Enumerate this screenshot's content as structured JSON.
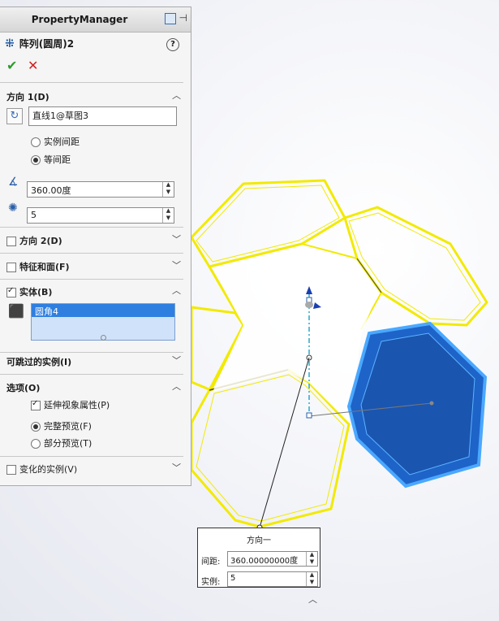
{
  "panel": {
    "title": "PropertyManager",
    "feature_name": "阵列(圆周)2",
    "help_label": "?",
    "ok_symbol": "✔",
    "cancel_symbol": "✕"
  },
  "direction1": {
    "title": "方向 1(D)",
    "axis_value": "直线1@草图3",
    "option_instance_spacing": "实例间距",
    "option_equal_spacing": "等间距",
    "angle_value": "360.00度",
    "count_value": "5"
  },
  "direction2": {
    "title": "方向 2(D)"
  },
  "features_faces": {
    "title": "特征和面(F)"
  },
  "bodies": {
    "title": "实体(B)",
    "selected": "圆角4"
  },
  "skip_instances": {
    "title": "可跳过的实例(I)"
  },
  "options": {
    "title": "选项(O)",
    "propagate": "延伸视象属性(P)",
    "full_preview": "完整预览(F)",
    "partial_preview": "部分预览(T)"
  },
  "vary_instances": {
    "title": "变化的实例(V)"
  },
  "callout": {
    "title": "方向一",
    "spacing_label": "间距:",
    "spacing_value": "360.00000000度",
    "instances_label": "实例:",
    "instances_value": "5"
  },
  "colors": {
    "preview": "#f5f000",
    "body": "#1e63c8",
    "accent": "#2f7fe0"
  }
}
